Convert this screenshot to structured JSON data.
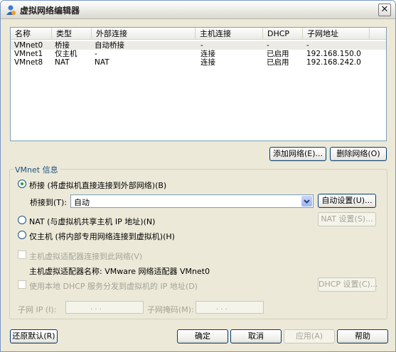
{
  "window": {
    "title": "虚拟网络编辑器",
    "close_symbol": "✕"
  },
  "columns": [
    "名称",
    "类型",
    "外部连接",
    "主机连接",
    "DHCP",
    "子网地址"
  ],
  "rows": [
    {
      "name": "VMnet0",
      "type": "桥接",
      "external": "自动桥接",
      "host": "-",
      "dhcp": "-",
      "subnet": "-",
      "selected": true
    },
    {
      "name": "VMnet1",
      "type": "仅主机",
      "external": "-",
      "host": "连接",
      "dhcp": "已启用",
      "subnet": "192.168.150.0",
      "selected": false
    },
    {
      "name": "VMnet8",
      "type": "NAT",
      "external": "NAT",
      "host": "连接",
      "dhcp": "已启用",
      "subnet": "192.168.242.0",
      "selected": false
    }
  ],
  "buttons": {
    "add_network": "添加网络(E)...",
    "remove_network": "删除网络(O)",
    "auto_settings": "自动设置(U)...",
    "nat_settings": "NAT 设置(S)...",
    "dhcp_settings": "DHCP 设置(C)...",
    "restore_defaults": "还原默认(R)",
    "ok": "确定",
    "cancel": "取消",
    "apply": "应用(A)",
    "help": "帮助"
  },
  "vmnet_info": {
    "title": "VMnet 信息",
    "bridge_radio": "桥接 (将虚拟机直接连接到外部网络)(B)",
    "bridge_to_label": "桥接到(T):",
    "bridge_to_value": "自动",
    "nat_radio": "NAT (与虚拟机共享主机 IP 地址)(N)",
    "hostonly_radio": "仅主机 (将内部专用网络连接到虚拟机)(H)",
    "connect_adapter": "主机虚拟适配器连接到此网络(V)",
    "adapter_name": "主机虚拟适配器名称: VMware 网络适配器 VMnet0",
    "use_dhcp": "使用本地 DHCP 服务分发到虚拟机的 IP 地址(D)",
    "subnet_ip_label": "子网 IP (I):",
    "subnet_mask_label": "子网掩码(M):",
    "ip_dots": ". . ."
  },
  "selected_mode": "bridge",
  "colors": {
    "window_bg": "#ece9d8",
    "selection": "#ecebe6",
    "accent_green": "#21a121",
    "group_title": "#1c5180"
  }
}
